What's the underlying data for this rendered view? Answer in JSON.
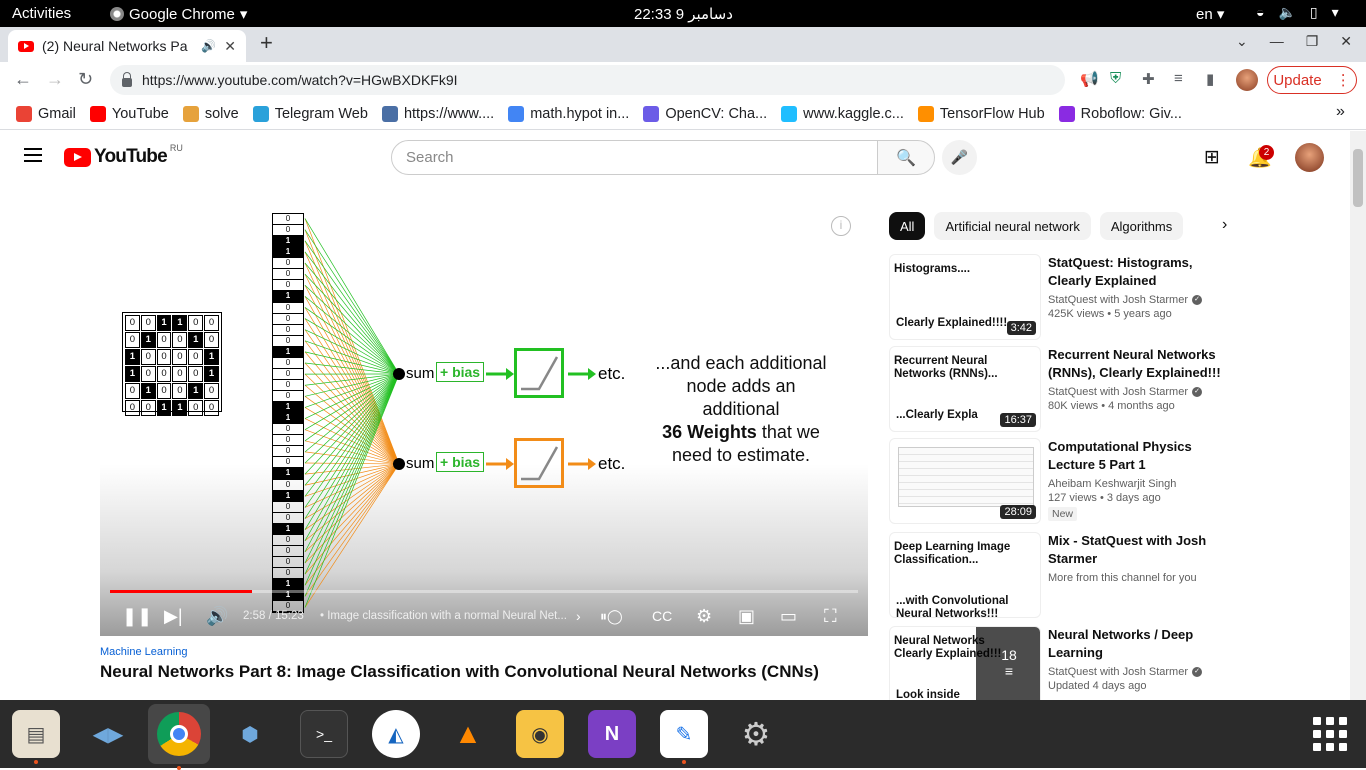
{
  "topbar": {
    "activities": "Activities",
    "app_name": "Google Chrome",
    "clock": "22:33  9 دسامبر",
    "lang": "en"
  },
  "tabs": {
    "active_title": "(2) Neural Networks Pa",
    "new_tab": "+"
  },
  "toolbar": {
    "url": "https://www.youtube.com/watch?v=HGwBXDKFk9I",
    "update_label": "Update"
  },
  "bookmarks": [
    {
      "label": "Gmail",
      "color": "#ea4335"
    },
    {
      "label": "YouTube",
      "color": "#ff0000"
    },
    {
      "label": "solve",
      "color": "#e6a23c"
    },
    {
      "label": "Telegram Web",
      "color": "#2aa1da"
    },
    {
      "label": "https://www....",
      "color": "#4a6fa5"
    },
    {
      "label": "math.hypot in...",
      "color": "#4285f4"
    },
    {
      "label": "OpenCV: Cha...",
      "color": "#6c5ce7"
    },
    {
      "label": "www.kaggle.c...",
      "color": "#20beff"
    },
    {
      "label": "TensorFlow Hub",
      "color": "#ff8f00"
    },
    {
      "label": "Roboflow: Giv...",
      "color": "#8a2be2"
    }
  ],
  "youtube": {
    "logo_text": "YouTube",
    "logo_region": "RU",
    "search_placeholder": "Search",
    "notification_count": "2"
  },
  "player": {
    "slide_text_1": "...and each additional node adds an additional",
    "slide_bold": "36 Weights",
    "slide_text_2": " that we need to estimate.",
    "node_sum": "sum",
    "bias_label": "+ bias",
    "etc": "etc.",
    "time_display": "2:58 / 15:23",
    "chapter_title": "• Image classification with a normal Neural Net...",
    "progress_fraction": 0.19,
    "grid": [
      [
        0,
        0,
        1,
        1,
        0,
        0
      ],
      [
        0,
        1,
        0,
        0,
        1,
        0
      ],
      [
        1,
        0,
        0,
        0,
        0,
        1
      ],
      [
        1,
        0,
        0,
        0,
        0,
        1
      ],
      [
        0,
        1,
        0,
        0,
        1,
        0
      ],
      [
        0,
        0,
        1,
        1,
        0,
        0
      ]
    ],
    "vector": [
      0,
      0,
      1,
      1,
      0,
      0,
      0,
      1,
      0,
      0,
      0,
      0,
      1,
      0,
      0,
      0,
      0,
      1,
      1,
      0,
      0,
      0,
      0,
      1,
      0,
      1,
      0,
      0,
      1,
      0,
      0,
      0,
      0,
      1,
      1,
      0
    ],
    "colors": {
      "top_path": "#22c022",
      "bottom_path": "#f28c18",
      "relu": "#888888"
    }
  },
  "video": {
    "category": "Machine Learning",
    "title": "Neural Networks Part 8: Image Classification with Convolutional Neural Networks (CNNs)"
  },
  "chips": [
    "All",
    "Artificial neural network",
    "Algorithms"
  ],
  "recommendations": [
    {
      "title": "StatQuest: Histograms, Clearly Explained",
      "channel": "StatQuest with Josh Starmer",
      "stats": "425K views • 5 years ago",
      "duration": "3:42",
      "thumb_top": "Histograms....",
      "thumb_bottom": "Clearly Explained!!!!"
    },
    {
      "title": "Recurrent Neural Networks (RNNs), Clearly Explained!!!",
      "channel": "StatQuest with Josh Starmer",
      "stats": "80K views • 4 months ago",
      "duration": "16:37",
      "thumb_top": "Recurrent Neural Networks (RNNs)...",
      "thumb_bottom": "...Clearly Expla"
    },
    {
      "title": "Computational Physics Lecture 5 Part 1",
      "channel": "Aheibam Keshwarjit Singh",
      "stats": "127 views • 3 days ago",
      "duration": "28:09",
      "badge": "New"
    },
    {
      "title": "Mix - StatQuest with Josh Starmer",
      "channel": "More from this channel for you",
      "thumb_top": "Deep Learning Image Classification...",
      "thumb_bottom": "...with Convolutional Neural Networks!!!"
    },
    {
      "title": "Neural Networks / Deep Learning",
      "channel": "StatQuest with Josh Starmer",
      "stats": "Updated 4 days ago",
      "playlist_count": "18",
      "thumb_top": "Neural Networks Clearly Explained!!!",
      "thumb_bottom": "Look inside"
    }
  ]
}
